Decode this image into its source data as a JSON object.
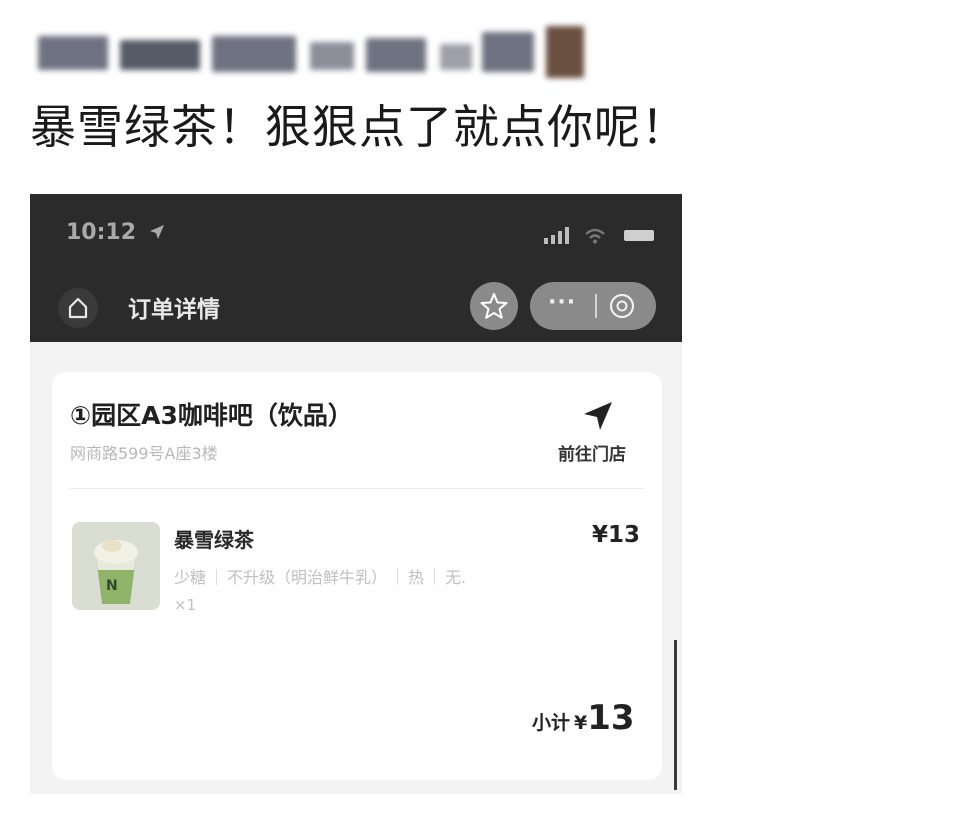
{
  "post": {
    "text": "暴雪绿茶！狠狠点了就点你呢！"
  },
  "screenshot": {
    "status_bar": {
      "time": "10:12",
      "location_icon": "location-arrow-icon",
      "signal_icon": "signal-bars-icon",
      "wifi_icon": "wifi-icon",
      "battery_icon": "battery-icon"
    },
    "nav_bar": {
      "title": "订单详情",
      "home_icon": "home-icon",
      "star_icon": "star-icon",
      "more_label": "···",
      "close_icon": "close-circle-icon"
    },
    "order": {
      "store_name": "①园区A3咖啡吧（饮品）",
      "store_address": "网商路599号A座3楼",
      "navigate_label": "前往门店",
      "navigate_icon": "navigation-arrow-icon",
      "item": {
        "name": "暴雪绿茶",
        "price": "¥13",
        "specs": [
          "少糖",
          "不升级（明治鲜牛乳）",
          "热",
          "无."
        ],
        "quantity": "×1"
      },
      "subtotal_label": "小计",
      "subtotal_currency": "¥",
      "subtotal_amount": "13"
    },
    "colors": {
      "nav_background": "#2b2b2b",
      "card_background": "#ffffff",
      "page_background": "#f3f3f3"
    }
  }
}
